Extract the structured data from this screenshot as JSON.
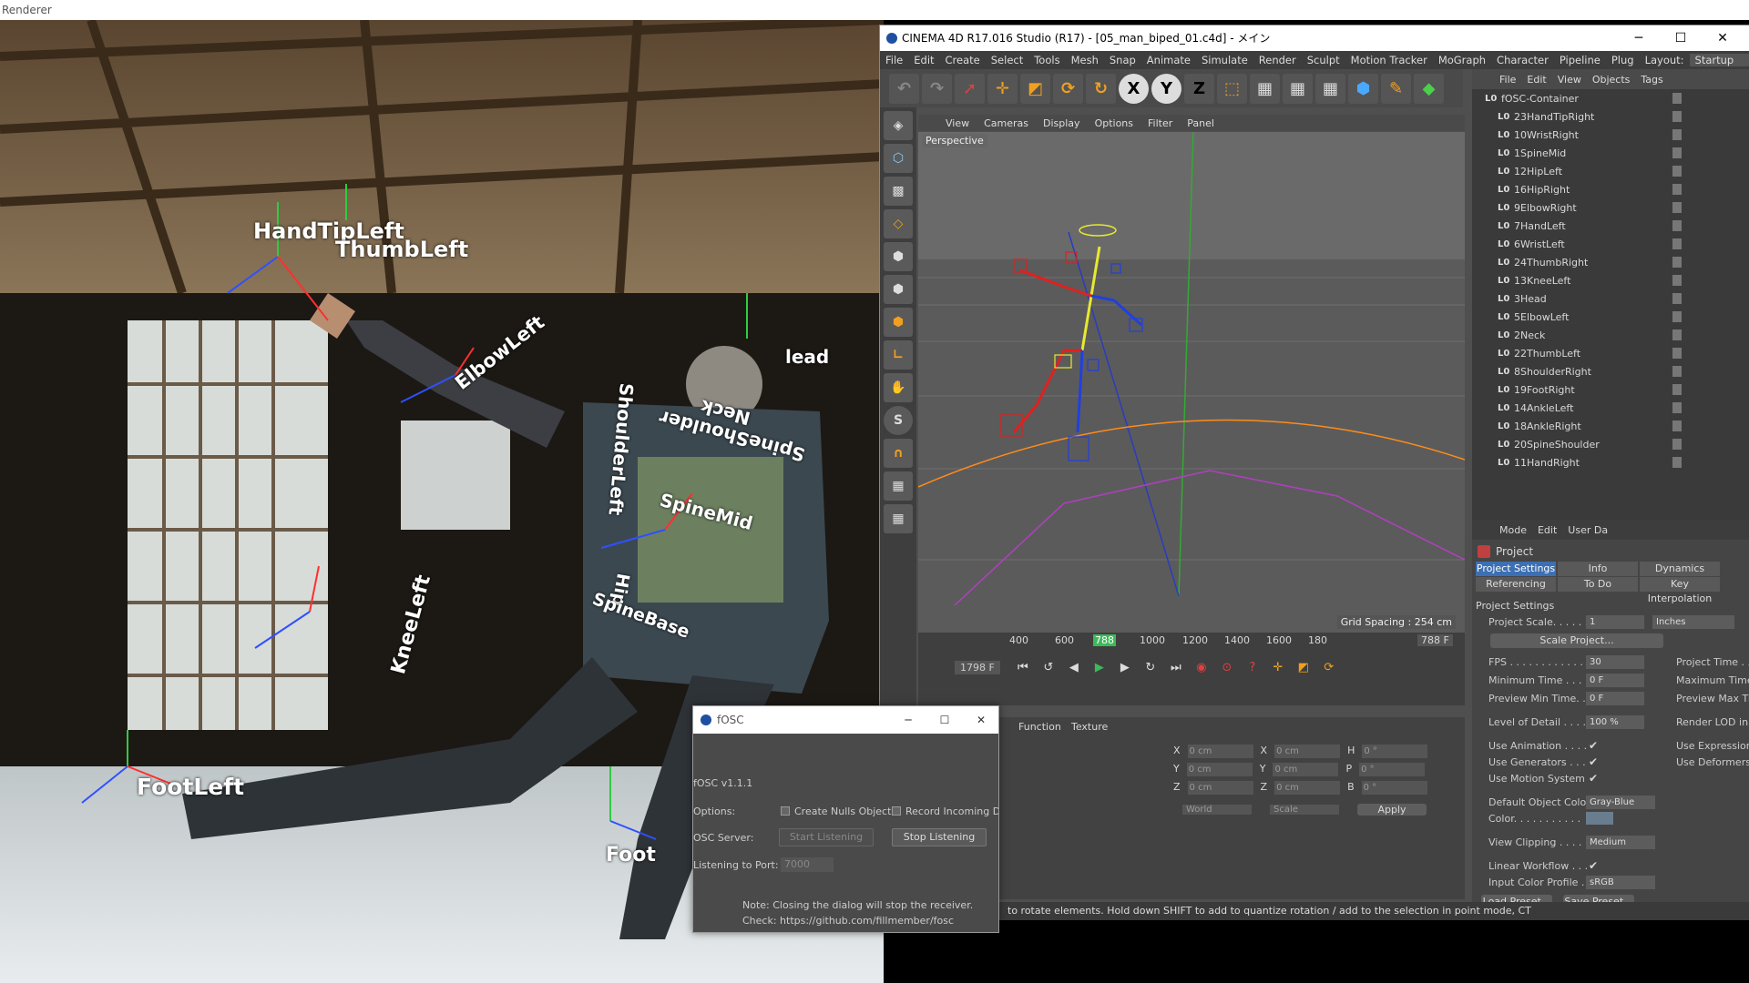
{
  "renderer": {
    "title": "Renderer"
  },
  "scene": {
    "joint_labels": [
      {
        "text": "HandTipLeft"
      },
      {
        "text": "ThumbLeft"
      },
      {
        "text": "ElbowLeft"
      },
      {
        "text": "lead"
      },
      {
        "text": "Neck"
      },
      {
        "text": "SpineShoulder"
      },
      {
        "text": "ShoulderLeft"
      },
      {
        "text": "SpineMid"
      },
      {
        "text": "Hip"
      },
      {
        "text": "SpineBase"
      },
      {
        "text": "KneeLeft"
      },
      {
        "text": "FootLeft"
      },
      {
        "text": "Foot"
      }
    ]
  },
  "c4d": {
    "title": "CINEMA 4D R17.016 Studio (R17) - [05_man_biped_01.c4d] - メイン",
    "menu": [
      "File",
      "Edit",
      "Create",
      "Select",
      "Tools",
      "Mesh",
      "Snap",
      "Animate",
      "Simulate",
      "Render",
      "Sculpt",
      "Motion Tracker",
      "MoGraph",
      "Character",
      "Pipeline",
      "Plug",
      "Layout:",
      "Startup"
    ],
    "toolbar": {
      "x": "X",
      "y": "Y",
      "z": "Z"
    },
    "viewport_menu": [
      "View",
      "Cameras",
      "Display",
      "Options",
      "Filter",
      "Panel"
    ],
    "viewport_label": "Perspective",
    "grid_spacing": "Grid Spacing : 254 cm",
    "timeline": {
      "ticks": [
        "400",
        "600",
        "788",
        "1000",
        "1200",
        "1400",
        "1600",
        "180"
      ],
      "current_frame": "788 F",
      "end_frame": "1798 F",
      "current_marker": "788"
    },
    "coords": {
      "tabs": [
        "Function",
        "Texture"
      ],
      "rows": [
        {
          "a": "X",
          "av": "0 cm",
          "b": "X",
          "bv": "0 cm",
          "c": "H",
          "cv": "0 °"
        },
        {
          "a": "Y",
          "av": "0 cm",
          "b": "Y",
          "bv": "0 cm",
          "c": "P",
          "cv": "0 °"
        },
        {
          "a": "Z",
          "av": "0 cm",
          "b": "Z",
          "bv": "0 cm",
          "c": "B",
          "cv": "0 °"
        }
      ],
      "world": "World",
      "scale": "Scale",
      "apply": "Apply"
    },
    "object_manager": {
      "menu": [
        "File",
        "Edit",
        "View",
        "Objects",
        "Tags"
      ],
      "objects": [
        "fOSC-Container",
        "23HandTipRight",
        "10WristRight",
        "1SpineMid",
        "12HipLeft",
        "16HipRight",
        "9ElbowRight",
        "7HandLeft",
        "6WristLeft",
        "24ThumbRight",
        "13KneeLeft",
        "3Head",
        "5ElbowLeft",
        "2Neck",
        "22ThumbLeft",
        "8ShoulderRight",
        "19FootRight",
        "14AnkleLeft",
        "18AnkleRight",
        "20SpineShoulder",
        "11HandRight"
      ]
    },
    "attributes": {
      "menu": [
        "Mode",
        "Edit",
        "User Da"
      ],
      "header": "Project",
      "tabs": [
        "Project Settings",
        "Info",
        "Dynamics",
        "Referencing",
        "To Do",
        "Key Interpolation"
      ],
      "section": "Project Settings",
      "project_scale_label": "Project Scale. . . . . .",
      "project_scale_value": "1",
      "project_scale_unit": "Inches",
      "scale_project": "Scale Project...",
      "fps_label": "FPS . . . . . . . . . . . . .",
      "fps_value": "30",
      "project_time_label": "Project Time . . .",
      "min_time_label": "Minimum Time . . . .",
      "min_time_value": "0 F",
      "max_time_label": "Maximum Time",
      "preview_min_label": "Preview Min Time. . .",
      "preview_min_value": "0 F",
      "preview_max_label": "Preview Max Ti",
      "lod_label": "Level of Detail . . . . .",
      "lod_value": "100 %",
      "render_lod_label": "Render LOD in E",
      "use_animation": "Use Animation . . . .",
      "use_expression": "Use Expression",
      "use_generators": "Use Generators . . .",
      "use_deformers": "Use Deformers",
      "use_motion": "Use Motion System",
      "default_color_label": "Default Object Color",
      "default_color_value": "Gray-Blue",
      "color_label": "Color. . . . . . . . . . .",
      "view_clipping_label": "View Clipping . . . . .",
      "view_clipping_value": "Medium",
      "linear_workflow": "Linear Workflow . . .",
      "input_profile_label": "Input Color Profile . .",
      "input_profile_value": "sRGB",
      "load_preset": "Load Preset...",
      "save_preset": "Save Preset..."
    },
    "status": "to rotate elements. Hold down SHIFT to add to quantize rotation / add to the selection in point mode, CT"
  },
  "fosc": {
    "title": "fOSC",
    "version": "fOSC v1.1.1",
    "options_label": "Options:",
    "create_nulls": "Create Nulls Objects",
    "record_incoming": "Record Incoming Dat",
    "server_label": "OSC Server:",
    "start": "Start Listening",
    "stop": "Stop Listening",
    "port_label": "Listening to Port:",
    "port_value": "7000",
    "note1": "Note: Closing the dialog will stop the receiver.",
    "note2": "Check: https://github.com/fillmember/fosc"
  }
}
